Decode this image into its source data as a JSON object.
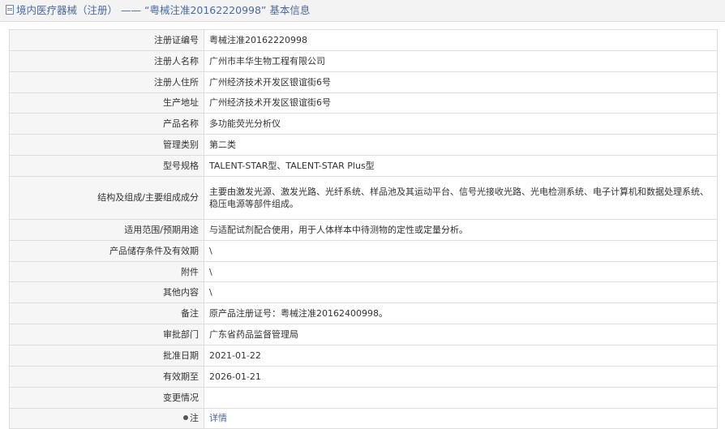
{
  "header": {
    "prefix": "境内医疗器械（注册）",
    "separator": " —— ",
    "title": "“粤械注准20162220998” 基本信息"
  },
  "rows": [
    {
      "label": "注册证编号",
      "value": "粤械注准20162220998"
    },
    {
      "label": "注册人名称",
      "value": "广州市丰华生物工程有限公司"
    },
    {
      "label": "注册人住所",
      "value": "广州经济技术开发区银谊街6号"
    },
    {
      "label": "生产地址",
      "value": "广州经济技术开发区银谊街6号"
    },
    {
      "label": "产品名称",
      "value": "多功能荧光分析仪"
    },
    {
      "label": "管理类别",
      "value": "第二类"
    },
    {
      "label": "型号规格",
      "value": "TALENT-STAR型、TALENT-STAR Plus型"
    },
    {
      "label": "结构及组成/主要组成成分",
      "value": "主要由激发光源、激发光路、光纤系统、样品池及其运动平台、信号光接收光路、光电检测系统、电子计算机和数据处理系统、稳压电源等部件组成。"
    },
    {
      "label": "适用范围/预期用途",
      "value": "与适配试剂配合使用，用于人体样本中待测物的定性或定量分析。"
    },
    {
      "label": "产品储存条件及有效期",
      "value": "\\"
    },
    {
      "label": "附件",
      "value": "\\"
    },
    {
      "label": "其他内容",
      "value": "\\"
    },
    {
      "label": "备注",
      "value": "原产品注册证号：粤械注准20162400998。"
    },
    {
      "label": "审批部门",
      "value": "广东省药品监督管理局"
    },
    {
      "label": "批准日期",
      "value": "2021-01-22"
    },
    {
      "label": "有效期至",
      "value": "2026-01-21"
    },
    {
      "label": "变更情况",
      "value": ""
    },
    {
      "label": "注",
      "value": "详情"
    }
  ],
  "colors": {
    "link": "#4b6aa0",
    "label_bg": "#f6f6f6",
    "border": "#dedede"
  },
  "icons": {
    "header": "document-icon",
    "note": "bullet-icon"
  }
}
